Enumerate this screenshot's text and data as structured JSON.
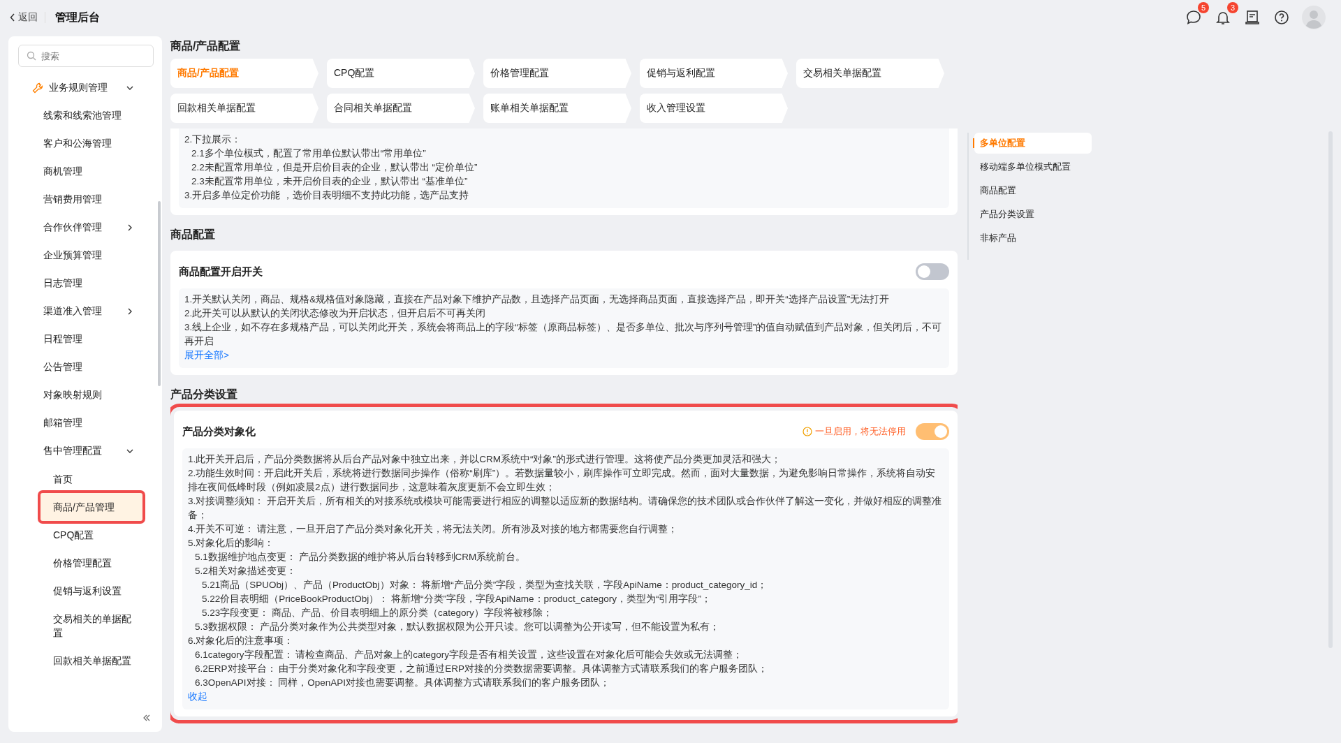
{
  "header": {
    "back": "返回",
    "title": "管理后台",
    "icons": [
      {
        "kind": "chat",
        "badge": "5"
      },
      {
        "kind": "bell",
        "badge": "3"
      },
      {
        "kind": "doc"
      },
      {
        "kind": "help"
      },
      {
        "kind": "avatar"
      }
    ]
  },
  "sidebar": {
    "search": {
      "placeholder": "搜索"
    },
    "items": [
      {
        "label": "业务规则管理",
        "expanded": true,
        "children": [
          {
            "label": "线索和线索池管理"
          },
          {
            "label": "客户和公海管理"
          },
          {
            "label": "商机管理"
          },
          {
            "label": "营销费用管理"
          },
          {
            "label": "合作伙伴管理",
            "expanded": false
          },
          {
            "label": "企业预算管理"
          },
          {
            "label": "日志管理"
          },
          {
            "label": "渠道准入管理",
            "expanded": false
          },
          {
            "label": "日程管理"
          },
          {
            "label": "公告管理"
          },
          {
            "label": "对象映射规则"
          },
          {
            "label": "邮箱管理"
          },
          {
            "label": "售中管理配置",
            "expanded": true,
            "children": [
              {
                "label": "首页",
                "selected": false,
                "highlighted": false
              },
              {
                "label": "商品/产品管理",
                "selected": true,
                "highlighted": true
              },
              {
                "label": "CPQ配置",
                "selected": false,
                "highlighted": false
              },
              {
                "label": "价格管理配置",
                "selected": false,
                "highlighted": false
              },
              {
                "label": "促销与返利设置",
                "selected": false,
                "highlighted": false
              },
              {
                "label": "交易相关的单据配置",
                "selected": false,
                "highlighted": false
              },
              {
                "label": "回款相关单据配置",
                "selected": false,
                "highlighted": false
              }
            ]
          }
        ]
      }
    ]
  },
  "page_title": "商品/产品配置",
  "tabs": [
    {
      "label": "商品/产品配置",
      "selected": true
    },
    {
      "label": "CPQ配置",
      "selected": false
    },
    {
      "label": "价格管理配置",
      "selected": false
    },
    {
      "label": "促销与返利配置",
      "selected": false
    },
    {
      "label": "交易相关单据配置",
      "selected": false
    },
    {
      "label": "回款相关单据配置",
      "selected": false
    },
    {
      "label": "合同相关单据配置",
      "selected": false
    },
    {
      "label": "账单相关单据配置",
      "selected": false
    },
    {
      "label": "收入管理设置",
      "selected": false
    }
  ],
  "sections": [
    {
      "cards": [
        {
          "highlighted": false,
          "lines": [
            {
              "text": "2.下拉展示：",
              "children": [
                {
                  "text": "2.1多个单位模式，配置了常用单位默认带出“常用单位”"
                },
                {
                  "text": "2.2未配置常用单位，但是开启价目表的企业，默认带出 “定价单位”"
                },
                {
                  "text": "2.3未配置常用单位，未开启价目表的企业，默认带出 “基准单位”"
                }
              ]
            },
            {
              "text": "3.开启多单位定价功能 ，选价目表明细不支持此功能，选产品支持"
            }
          ]
        }
      ]
    },
    {
      "title": "商品配置",
      "cards": [
        {
          "title": "商品配置开启开关",
          "highlighted": false,
          "switch": {
            "on": false,
            "disabled": false
          },
          "lines": [
            {
              "text": "1.开关默认关闭，商品、规格&规格值对象隐藏，直接在产品对象下维护产品数，且选择产品页面，无选择商品页面，直接选择产品，即开关“选择产品设置”无法打开"
            },
            {
              "text": "2.此开关可以从默认的关闭状态修改为开启状态，但开启后不可再关闭"
            },
            {
              "text": "3.线上企业，如不存在多规格产品，可以关闭此开关，系统会将商品上的字段“标签（原商品标签）、是否多单位、批次与序列号管理”的值自动赋值到产品对象，但关闭后，不可再开启"
            }
          ],
          "link": "展开全部>"
        }
      ]
    },
    {
      "title": "产品分类设置",
      "cards": [
        {
          "title": "产品分类对象化",
          "highlighted": true,
          "warning": "一旦启用，将无法停用",
          "switch": {
            "on": true,
            "disabled": true
          },
          "lines": [
            {
              "text": "1.此开关开启后，产品分类数据将从后台产品对象中独立出来，并以CRM系统中“对象”的形式进行管理。这将使产品分类更加灵活和强大；"
            },
            {
              "text": "2.功能生效时间：开启此开关后，系统将进行数据同步操作（俗称“刷库”）。若数据量较小，刷库操作可立即完成。然而，面对大量数据，为避免影响日常操作，系统将自动安排在夜间低峰时段（例如凌晨2点）进行数据同步，这意味着灰度更新不会立即生效；"
            },
            {
              "text": "3.对接调整须知： 开启开关后，所有相关的对接系统或模块可能需要进行相应的调整以适应新的数据结构。请确保您的技术团队或合作伙伴了解这一变化，并做好相应的调整准备；"
            },
            {
              "text": "4.开关不可逆： 请注意，一旦开启了产品分类对象化开关，将无法关闭。所有涉及对接的地方都需要您自行调整；"
            },
            {
              "text": "5.对象化后的影响：",
              "children": [
                {
                  "text": "5.1数据维护地点变更： 产品分类数据的维护将从后台转移到CRM系统前台。"
                },
                {
                  "text": "5.2相关对象描述变更：",
                  "children": [
                    {
                      "text": "5.21商品（SPUObj）、产品（ProductObj）对象： 将新增“产品分类”字段，类型为查找关联，字段ApiName：product_category_id；"
                    },
                    {
                      "text": "5.22价目表明细（PriceBookProductObj）： 将新增“分类”字段，字段ApiName：product_category，类型为“引用字段”；"
                    },
                    {
                      "text": "5.23字段变更： 商品、产品、价目表明细上的原分类（category）字段将被移除；"
                    }
                  ]
                },
                {
                  "text": "5.3数据权限： 产品分类对象作为公共类型对象，默认数据权限为公开只读。您可以调整为公开读写，但不能设置为私有；"
                }
              ]
            },
            {
              "text": "6.对象化后的注意事项：",
              "children": [
                {
                  "text": "6.1category字段配置： 请检查商品、产品对象上的category字段是否有相关设置，这些设置在对象化后可能会失效或无法调整；"
                },
                {
                  "text": "6.2ERP对接平台： 由于分类对象化和字段变更，之前通过ERP对接的分类数据需要调整。具体调整方式请联系我们的客户服务团队；"
                },
                {
                  "text": "6.3OpenAPI对接： 同样，OpenAPI对接也需要调整。具体调整方式请联系我们的客户服务团队；"
                }
              ]
            }
          ],
          "link": "收起"
        }
      ]
    }
  ],
  "anchor_nav": [
    {
      "label": "多单位配置",
      "selected": true
    },
    {
      "label": "移动端多单位模式配置",
      "selected": false
    },
    {
      "label": "商品配置",
      "selected": false
    },
    {
      "label": "产品分类设置",
      "selected": false
    },
    {
      "label": "非标产品",
      "selected": false
    }
  ]
}
